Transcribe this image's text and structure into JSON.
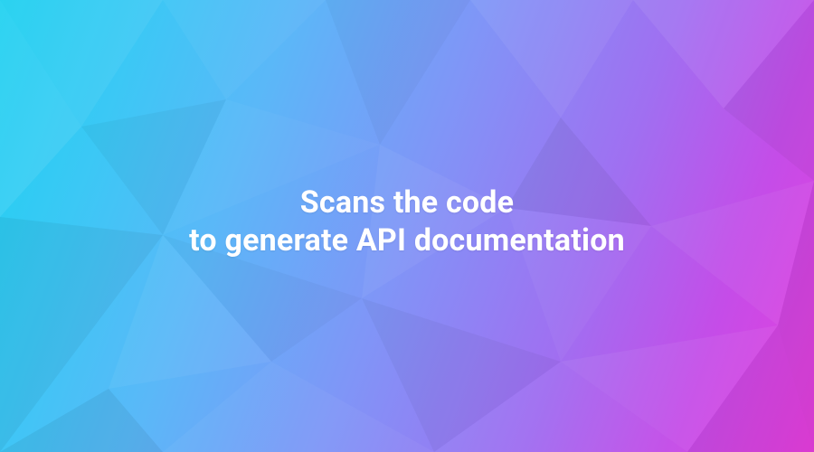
{
  "headline": {
    "line1": "Scans the code",
    "line2": "to generate API documentation"
  },
  "colors": {
    "gradient_start": "#1dd1f0",
    "gradient_end": "#e63edd",
    "text": "#ffffff"
  }
}
